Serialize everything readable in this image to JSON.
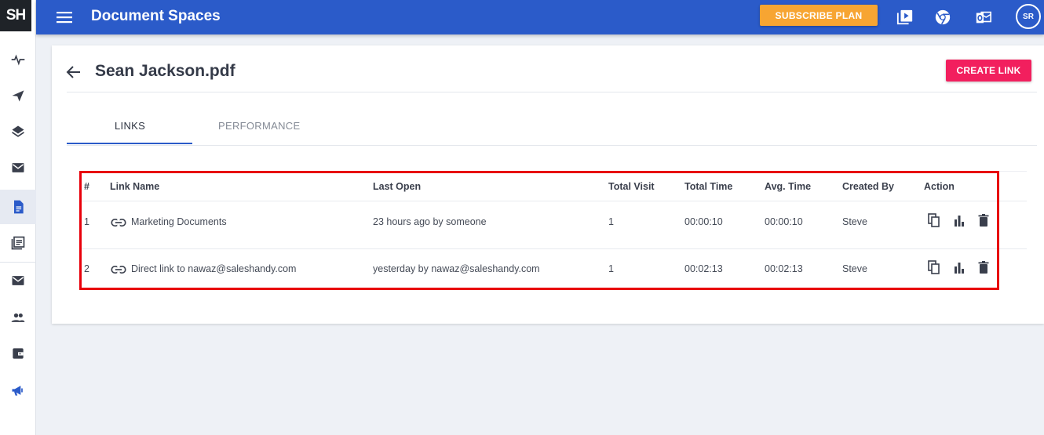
{
  "app": {
    "logo": "SH",
    "title": "Document Spaces"
  },
  "topbar": {
    "subscribe_label": "SUBSCRIBE PLAN",
    "icons": [
      "video-icon",
      "chrome-icon",
      "outlook-icon"
    ],
    "avatar": "SR"
  },
  "sidebar": {
    "items": [
      "activity-icon",
      "send-icon",
      "layers-icon",
      "mail-icon",
      "document-icon",
      "library-icon",
      "envelope-icon",
      "people-icon",
      "wallet-icon",
      "megaphone-icon"
    ],
    "active": "document-icon"
  },
  "page": {
    "title": "Sean Jackson.pdf",
    "create_link_label": "CREATE LINK"
  },
  "tabs": [
    {
      "label": "LINKS",
      "active": true
    },
    {
      "label": "PERFORMANCE",
      "active": false
    }
  ],
  "table": {
    "headers": [
      "#",
      "Link Name",
      "Last Open",
      "Total Visit",
      "Total Time",
      "Avg. Time",
      "Created By",
      "Action"
    ],
    "rows": [
      {
        "num": "1",
        "name": "Marketing Documents",
        "last_open": "23 hours ago by someone",
        "visits": "1",
        "total_time": "00:00:10",
        "avg_time": "00:00:10",
        "created_by": "Steve"
      },
      {
        "num": "2",
        "name": "Direct link to nawaz@saleshandy.com",
        "last_open": "yesterday by nawaz@saleshandy.com",
        "visits": "1",
        "total_time": "00:02:13",
        "avg_time": "00:02:13",
        "created_by": "Steve"
      }
    ],
    "actions": [
      "copy-icon",
      "chart-icon",
      "delete-icon"
    ]
  },
  "colors": {
    "primary": "#2b5bc9",
    "accent_orange": "#f7a532",
    "accent_pink": "#f21f5e",
    "highlight": "#e8000b"
  }
}
